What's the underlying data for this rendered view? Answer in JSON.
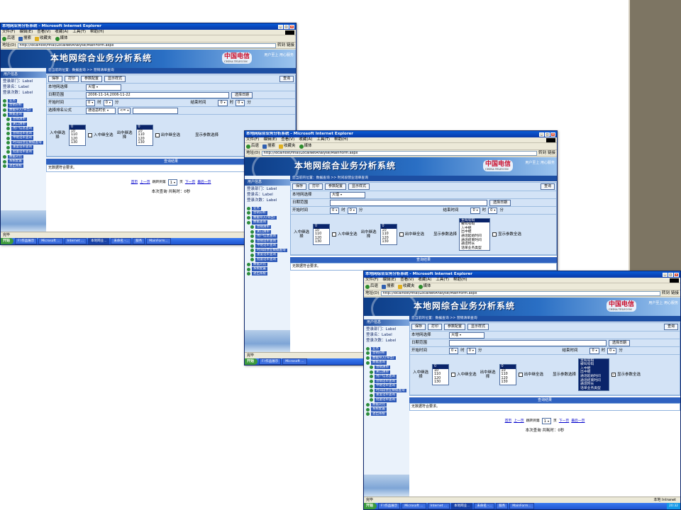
{
  "windows": [
    {
      "title": "本地网业务分析系统 - Microsoft Internet Explorer",
      "menu": [
        "文件(F)",
        "编辑(E)",
        "查看(V)",
        "收藏(A)",
        "工具(T)",
        "帮助(H)"
      ],
      "toolbar": [
        "后退",
        "搜索",
        "收藏夹",
        "媒体"
      ],
      "address_label": "地址(D)",
      "address": "http://localhost/final/LocalNetAnalyse/MainForm.aspx",
      "go_label": "转到",
      "links_label": "链接",
      "banner_title": "本地网综合业务分析系统",
      "brand_name": "中国电信",
      "brand_sub": "CHINA TELECOM",
      "slogan": "用户至上 用心服务",
      "user_panel_title": "用户信息",
      "user_info": [
        "登录部门：Label",
        "登录名：Label",
        "登录次数：Label"
      ],
      "breadcrumb": "您当前的位置：数据查询 >> 营销清单查询",
      "buttons": [
        "保存",
        "打印",
        "参数配置",
        "显示样式"
      ],
      "search_button": "查询",
      "region_label": "本地网选择",
      "region_value": "大理",
      "date_label": "日期范围",
      "date_value": "2006-11-14,2006-11-22",
      "date_button": "选择日期",
      "start_label": "开始时间",
      "end_label": "结束时间",
      "hour_value": "0",
      "hour_unit": "时",
      "min_value": "0",
      "min_unit": "分",
      "sort_label": "选择排名公式",
      "sort_value": "通话总时长",
      "sort_op": "<=",
      "in_relay_label": "入中继选择",
      "out_relay_label": "出中继选择",
      "relay_options": [
        "0",
        "10",
        "110",
        "120",
        "130"
      ],
      "in_all_label": "入中继全选",
      "out_all_label": "出中继全选",
      "display_param_label": "显示参数选择",
      "display_params": [
        "主叫号码",
        "被叫号码",
        "入中继",
        "出中继",
        "通话起始时间",
        "通话结束时间",
        "通话时长",
        "话单业务类型"
      ],
      "display_all_label": "显示参数全选",
      "result_header": "查询结果",
      "no_data_msg": "无数据符合要求。",
      "pager": [
        "首页",
        "上一页",
        "跳转到第",
        "1",
        "页",
        "下一页",
        "最后一页"
      ],
      "stats": "本次查询 共耗时：0秒",
      "tree": [
        "业务",
        "营销分析",
        "数据导入(导出)",
        "数据查询",
        "营销清单",
        "关口清单",
        "用户信息查询",
        "营销话单查询",
        "中继话单查询",
        "时间段营业数据查询",
        "重复话单查询",
        "批量话单查询",
        "数据对比",
        "系统配置",
        "退出系统"
      ],
      "status": "完毕",
      "zone": "本地 Intranet",
      "taskbar_start": "开始",
      "taskbar_items": [
        "F:\\作品展示",
        "Microsoft ...",
        "Internet ...",
        "本地网业...",
        "未命名 -...",
        "服务",
        "MainForm..."
      ],
      "clock": "20:32"
    },
    {
      "title": "本地网综合业务分析系统 - Microsoft Internet Explorer",
      "menu": [
        "文件(F)",
        "编辑(E)",
        "查看(V)",
        "收藏(A)",
        "工具(T)",
        "帮助(H)"
      ],
      "toolbar": [
        "后退",
        "搜索",
        "收藏夹",
        "媒体"
      ],
      "address_label": "地址(D)",
      "address": "http://localhost/final/LocalNetAnalyse/MainForm.aspx",
      "go_label": "转到",
      "links_label": "链接",
      "banner_title": "本地网综合业务分析系统",
      "brand_name": "中国电信",
      "brand_sub": "CHINA TELECOM",
      "slogan": "用户至上 用心服务",
      "user_panel_title": "用户信息",
      "user_info": [
        "登录部门：Label",
        "登录名：Label",
        "登录次数：Label"
      ],
      "breadcrumb": "您当前的位置：数据查询 >> 时间段营业话单查询",
      "buttons": [
        "保存",
        "打印",
        "参数配置",
        "显示样式"
      ],
      "search_button": "查询",
      "region_label": "本地网选择",
      "region_value": "大理",
      "date_label": "日期范围",
      "date_value": "",
      "date_button": "选择日期",
      "start_label": "开始时间",
      "end_label": "结束时间",
      "hour_value": "0",
      "hour_unit": "时",
      "min_value": "0",
      "min_unit": "分",
      "in_relay_label": "入中继选择",
      "out_relay_label": "出中继选择",
      "relay_options": [
        "0",
        "10",
        "110",
        "120",
        "130"
      ],
      "in_all_label": "入中继全选",
      "out_all_label": "出中继全选",
      "display_param_label": "显示参数选择",
      "display_params": [
        "主叫号码",
        "被叫号码",
        "入中继",
        "出中继",
        "通话起始时间",
        "通话结束时间",
        "通话时长",
        "话单业务类型"
      ],
      "display_all_label": "显示参数全选",
      "result_header": "查询结果",
      "no_data_msg": "无数据符合要求。",
      "tree": [
        "业务",
        "营销分析",
        "数据导入(导出)",
        "数据查询",
        "营销清单",
        "关口清单",
        "用户信息查询",
        "营销话单查询",
        "中继话单查询",
        "时间段营业数据查询",
        "重复话单查询",
        "批量话单查询",
        "数据对比",
        "系统配置",
        "退出系统"
      ],
      "status": "完毕",
      "taskbar_start": "开始",
      "taskbar_items": [
        "F:\\作品展示",
        "Microsoft ..."
      ]
    },
    {
      "title": "本地网综合业务分析系统 - Microsoft Internet Explorer",
      "menu": [
        "文件(F)",
        "编辑(E)",
        "查看(V)",
        "收藏(A)",
        "工具(T)",
        "帮助(H)"
      ],
      "toolbar": [
        "后退",
        "搜索",
        "收藏夹",
        "媒体"
      ],
      "address_label": "地址(D)",
      "address": "http://localhost/final/LocalNetAnalyse/MainForm.aspx",
      "go_label": "转到",
      "links_label": "链接",
      "banner_title": "本地网综合业务分析系统",
      "brand_name": "中国电信",
      "brand_sub": "CHINA TELECOM",
      "slogan": "用户至上 用心服务",
      "user_panel_title": "用户信息",
      "user_info": [
        "登录部门：Label",
        "登录名：Label",
        "登录次数：Label"
      ],
      "breadcrumb": "您当前的位置：数据查询 >> 营销清单查询",
      "buttons": [
        "保存",
        "打印",
        "参数配置",
        "显示样式"
      ],
      "search_button": "查询",
      "region_label": "本地网选择",
      "region_value": "大理",
      "date_label": "日期范围",
      "date_value": "",
      "date_button": "选择日期",
      "start_label": "开始时间",
      "end_label": "结束时间",
      "hour_value": "0",
      "hour_unit": "时",
      "min_value": "0",
      "min_unit": "分",
      "in_relay_label": "入中继选择",
      "out_relay_label": "出中继选择",
      "relay_options": [
        "0",
        "10",
        "110",
        "120",
        "130"
      ],
      "in_all_label": "入中继全选",
      "out_all_label": "出中继全选",
      "display_param_label": "显示参数选择",
      "display_params": [
        "主叫号码",
        "被叫号码",
        "入中继",
        "出中继",
        "通话起始时间",
        "通话结束时间",
        "通话时长",
        "话单业务类型"
      ],
      "display_all_label": "显示参数全选",
      "result_header": "查询结果",
      "no_data_msg": "无数据符合要求。",
      "pager": [
        "首页",
        "上一页",
        "跳转到第",
        "1",
        "页",
        "下一页",
        "最后一页"
      ],
      "stats": "本次查询 共耗时：0秒",
      "tree": [
        "业务",
        "营销分析",
        "数据导入(导出)",
        "数据查询",
        "营销清单",
        "关口清单",
        "用户信息查询",
        "营销话单查询",
        "中继话单查询",
        "时间段营业数据查询",
        "重复话单查询",
        "批量话单查询",
        "数据对比",
        "系统配置",
        "退出系统"
      ],
      "status": "完毕",
      "zone": "本地 Intranet",
      "taskbar_start": "开始",
      "taskbar_items": [
        "F:\\作品展示",
        "Microsoft ...",
        "Internet ...",
        "本地网业...",
        "未命名 -...",
        "服务",
        "MainForm..."
      ],
      "clock": "20:32"
    }
  ]
}
